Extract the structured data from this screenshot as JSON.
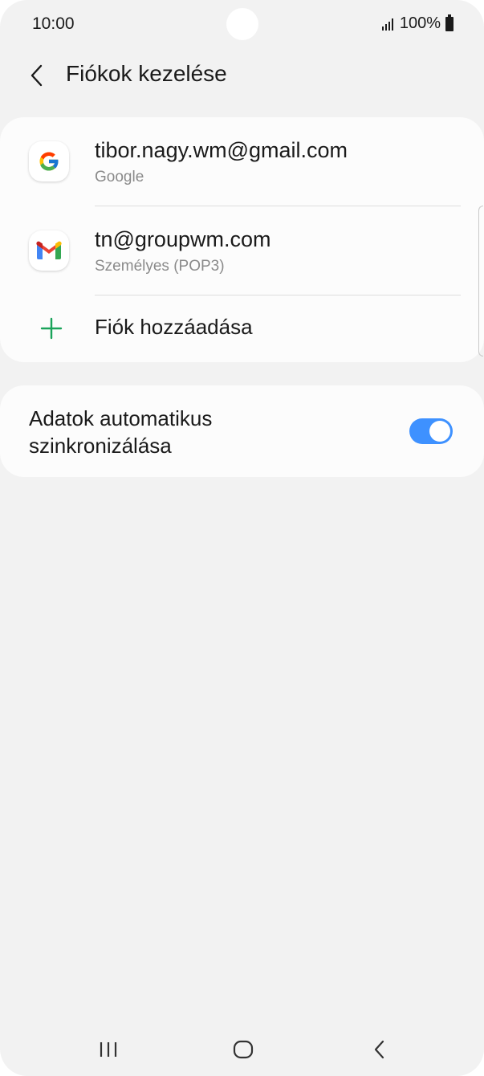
{
  "status_bar": {
    "time": "10:00",
    "battery": "100%"
  },
  "header": {
    "title": "Fiókok kezelése",
    "back_icon": "chevron-left-icon"
  },
  "accounts": [
    {
      "email": "tibor.nagy.wm@gmail.com",
      "type": "Google",
      "icon": "google-icon"
    },
    {
      "email": "tn@groupwm.com",
      "type": "Személyes (POP3)",
      "icon": "gmail-icon"
    }
  ],
  "add_account": {
    "label": "Fiók hozzáadása",
    "icon": "plus-icon",
    "icon_color": "#1aa35a"
  },
  "sync": {
    "label_line1": "Adatok automatikus",
    "label_line2": "szinkronizálása",
    "enabled": true,
    "toggle_color": "#3e91ff"
  },
  "nav_bar": {
    "items": [
      "recents-icon",
      "home-icon",
      "back-icon"
    ]
  }
}
